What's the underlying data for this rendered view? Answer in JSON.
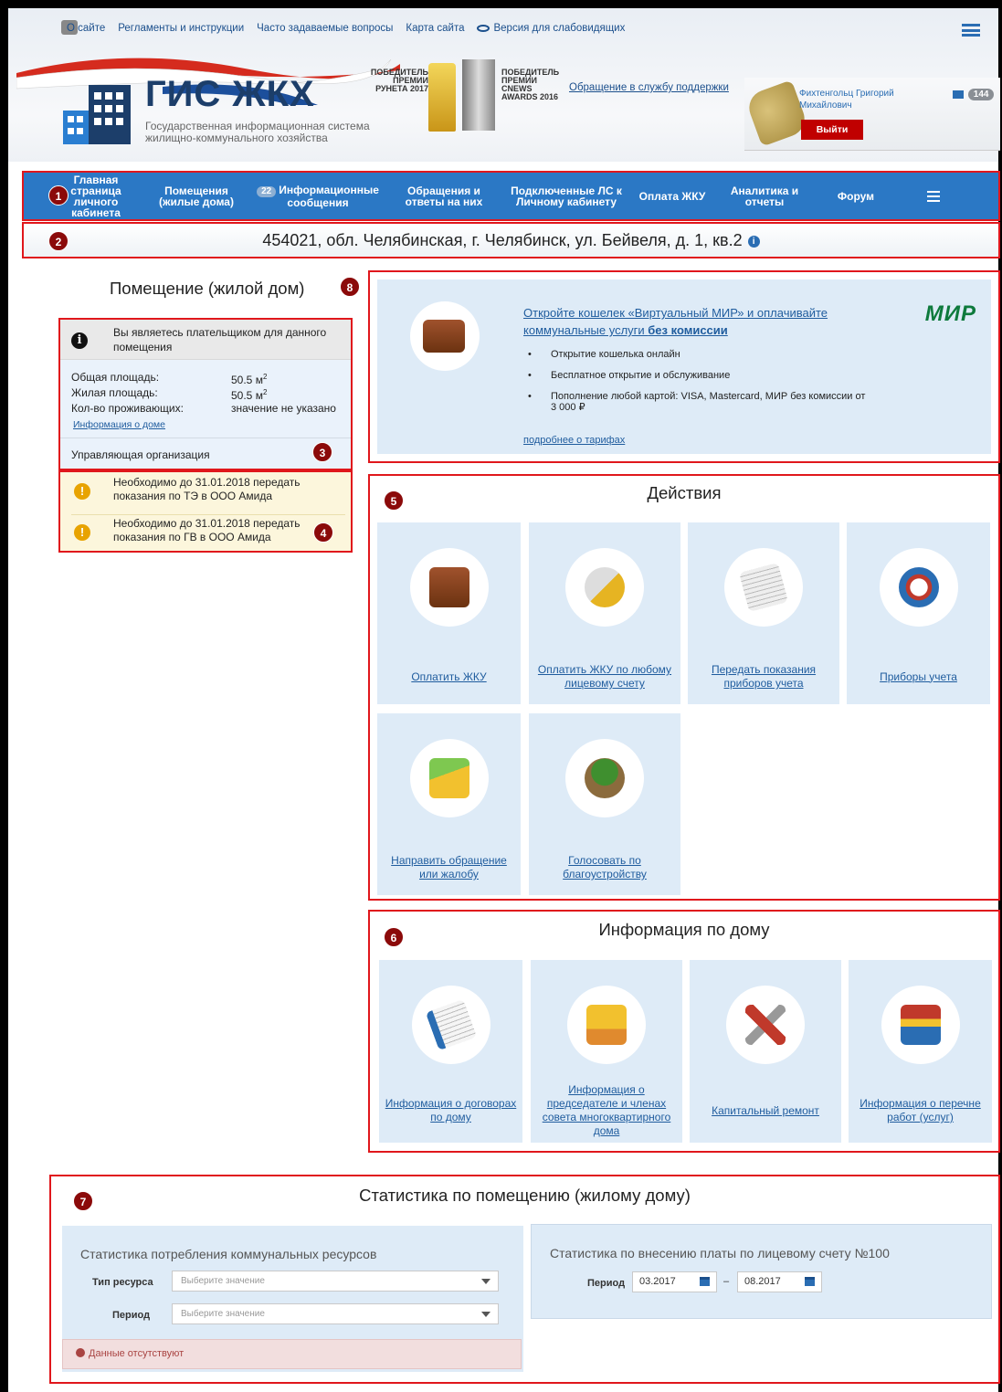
{
  "header": {
    "top_links": [
      "О сайте",
      "Регламенты и инструкции",
      "Часто задаваемые вопросы",
      "Карта сайта",
      "Версия для слабовидящих"
    ],
    "logo_title": "ГИС ЖКХ",
    "logo_subtitle": "Государственная информационная система жилищно-коммунального хозяйства",
    "award1": "ПОБЕДИТЕЛЬ ПРЕМИИ РУНЕТА 2017",
    "award2": "ПОБЕДИТЕЛЬ ПРЕМИИ CNEWS AWARDS 2016",
    "support_link": "Обращение в службу поддержки",
    "user_name": "Фихтенгольц Григорий Михайлович",
    "logout": "Выйти",
    "mail_count": "144"
  },
  "nav": {
    "items": [
      "Главная страница личного кабинета",
      "Помещения (жилые дома)",
      "Информационные сообщения",
      "Обращения и ответы на них",
      "Подключенные ЛС к Личному кабинету",
      "Оплата ЖКУ",
      "Аналитика и отчеты",
      "Форум"
    ],
    "messages_badge": "22"
  },
  "markers": [
    "1",
    "2",
    "3",
    "4",
    "5",
    "6",
    "7",
    "8"
  ],
  "address": "454021, обл. Челябинская, г. Челябинск, ул. Бейвеля, д. 1, кв.2",
  "room": {
    "title": "Помещение (жилой дом)",
    "payer_note": "Вы являетесь плательщиком для данного помещения",
    "total_area_label": "Общая площадь:",
    "total_area_value": "50.5 м",
    "living_area_label": "Жилая площадь:",
    "living_area_value": "50.5 м",
    "area_sup": "2",
    "residents_label": "Кол-во проживающих:",
    "residents_value": "значение не указано",
    "house_info_link": "Информация о доме",
    "management_org": "Управляющая организация"
  },
  "warnings": [
    "Необходимо до 31.01.2018 передать показания по ТЭ в ООО Амида",
    "Необходимо до 31.01.2018 передать показания по ГВ в ООО Амида"
  ],
  "promo": {
    "title_part1": "Откройте кошелек «Виртуальный МИР» и оплачивайте коммунальные услуги ",
    "title_bold": "без комиссии",
    "bullets": [
      "Открытие кошелька онлайн",
      "Бесплатное открытие и обслуживание",
      "Пополнение любой картой: VISA, Mastercard, МИР без комиссии от 3 000 ₽"
    ],
    "more_link": "подробнее о тарифах",
    "brand": "МИР"
  },
  "actions": {
    "title": "Действия",
    "tiles": [
      "Оплатить ЖКУ",
      "Оплатить ЖКУ по любому лицевому счету",
      "Передать показания приборов учета",
      "Приборы учета",
      "Направить обращение или жалобу",
      "Голосовать по благоустройству"
    ]
  },
  "house_info": {
    "title": "Информация по дому",
    "tiles": [
      "Информация о договорах по дому",
      "Информация о председателе и членах совета многоквартирного дома",
      "Капитальный ремонт",
      "Информация о перечне работ (услуг)"
    ]
  },
  "stats": {
    "title": "Статистика по помещению (жилому дому)",
    "consumption_title": "Статистика потребления коммунальных ресурсов",
    "resource_type_label": "Тип ресурса",
    "resource_type_placeholder": "Выберите значение",
    "period_label": "Период",
    "period_placeholder": "Выберите значение",
    "no_data": "Данные отсутствуют",
    "payment_title": "Статистика по внесению платы по лицевому счету №100",
    "payment_period_label": "Период",
    "date_from": "03.2017",
    "date_sep": "–",
    "date_to": "08.2017"
  }
}
